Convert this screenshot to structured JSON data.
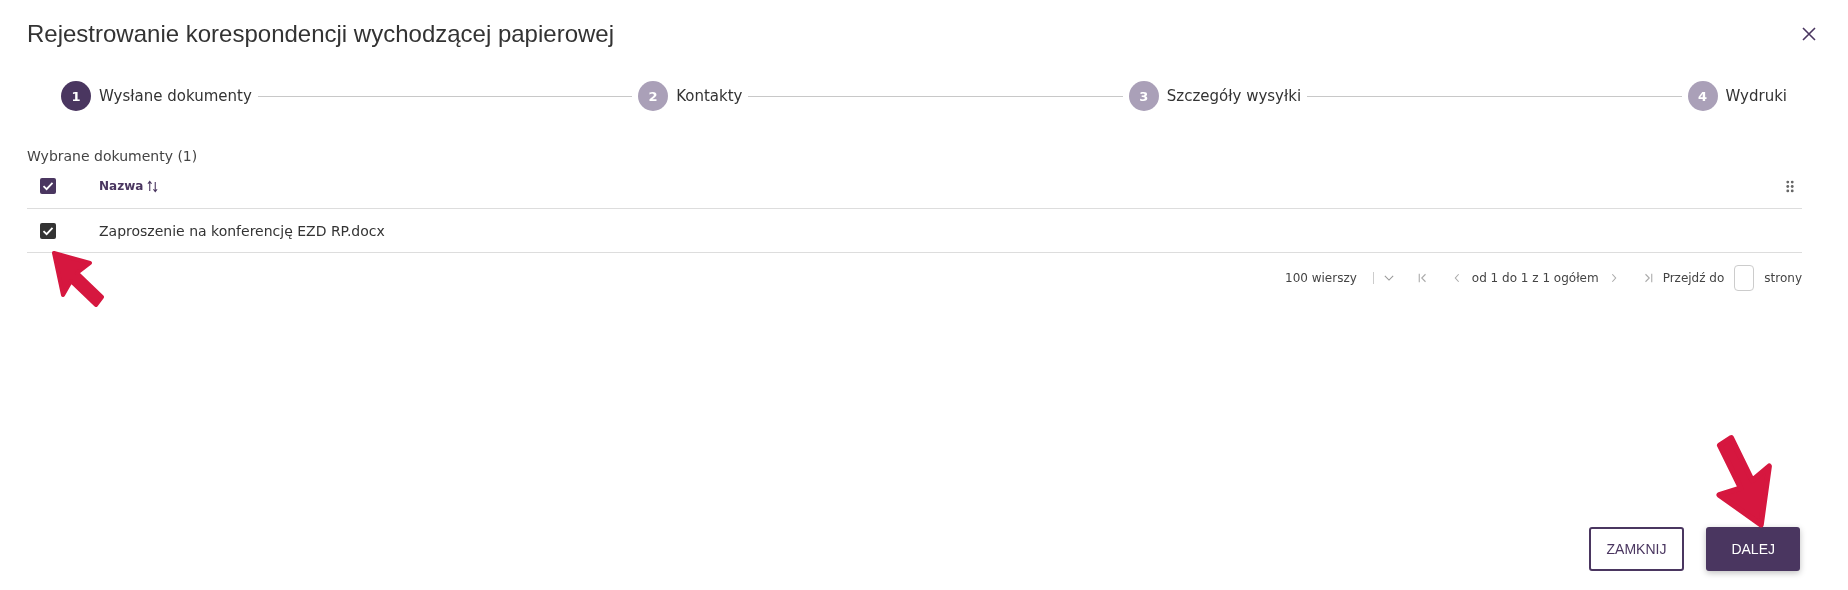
{
  "dialog": {
    "title": "Rejestrowanie korespondencji wychodzącej papierowej"
  },
  "steps": [
    {
      "number": "1",
      "label": "Wysłane dokumenty",
      "selected": true
    },
    {
      "number": "2",
      "label": "Kontakty",
      "selected": false
    },
    {
      "number": "3",
      "label": "Szczegóły wysyłki",
      "selected": false
    },
    {
      "number": "4",
      "label": "Wydruki",
      "selected": false
    }
  ],
  "table": {
    "caption": "Wybrane dokumenty (1)",
    "all_checked": true,
    "columns": [
      {
        "label": "Nazwa"
      }
    ],
    "rows": [
      {
        "checked": true,
        "cells": [
          "Zaproszenie na konferencję EZD RP.docx"
        ]
      }
    ]
  },
  "pagination": {
    "rows_per_page": "100 wierszy",
    "range": "od 1 do 1 z 1 ogółem",
    "goto_label": "Przejdź do",
    "goto_suffix": "strony"
  },
  "buttons": [
    {
      "label": "ZAMKNIJ",
      "kind": "secondary"
    },
    {
      "label": "DALEJ",
      "kind": "primary"
    }
  ]
}
